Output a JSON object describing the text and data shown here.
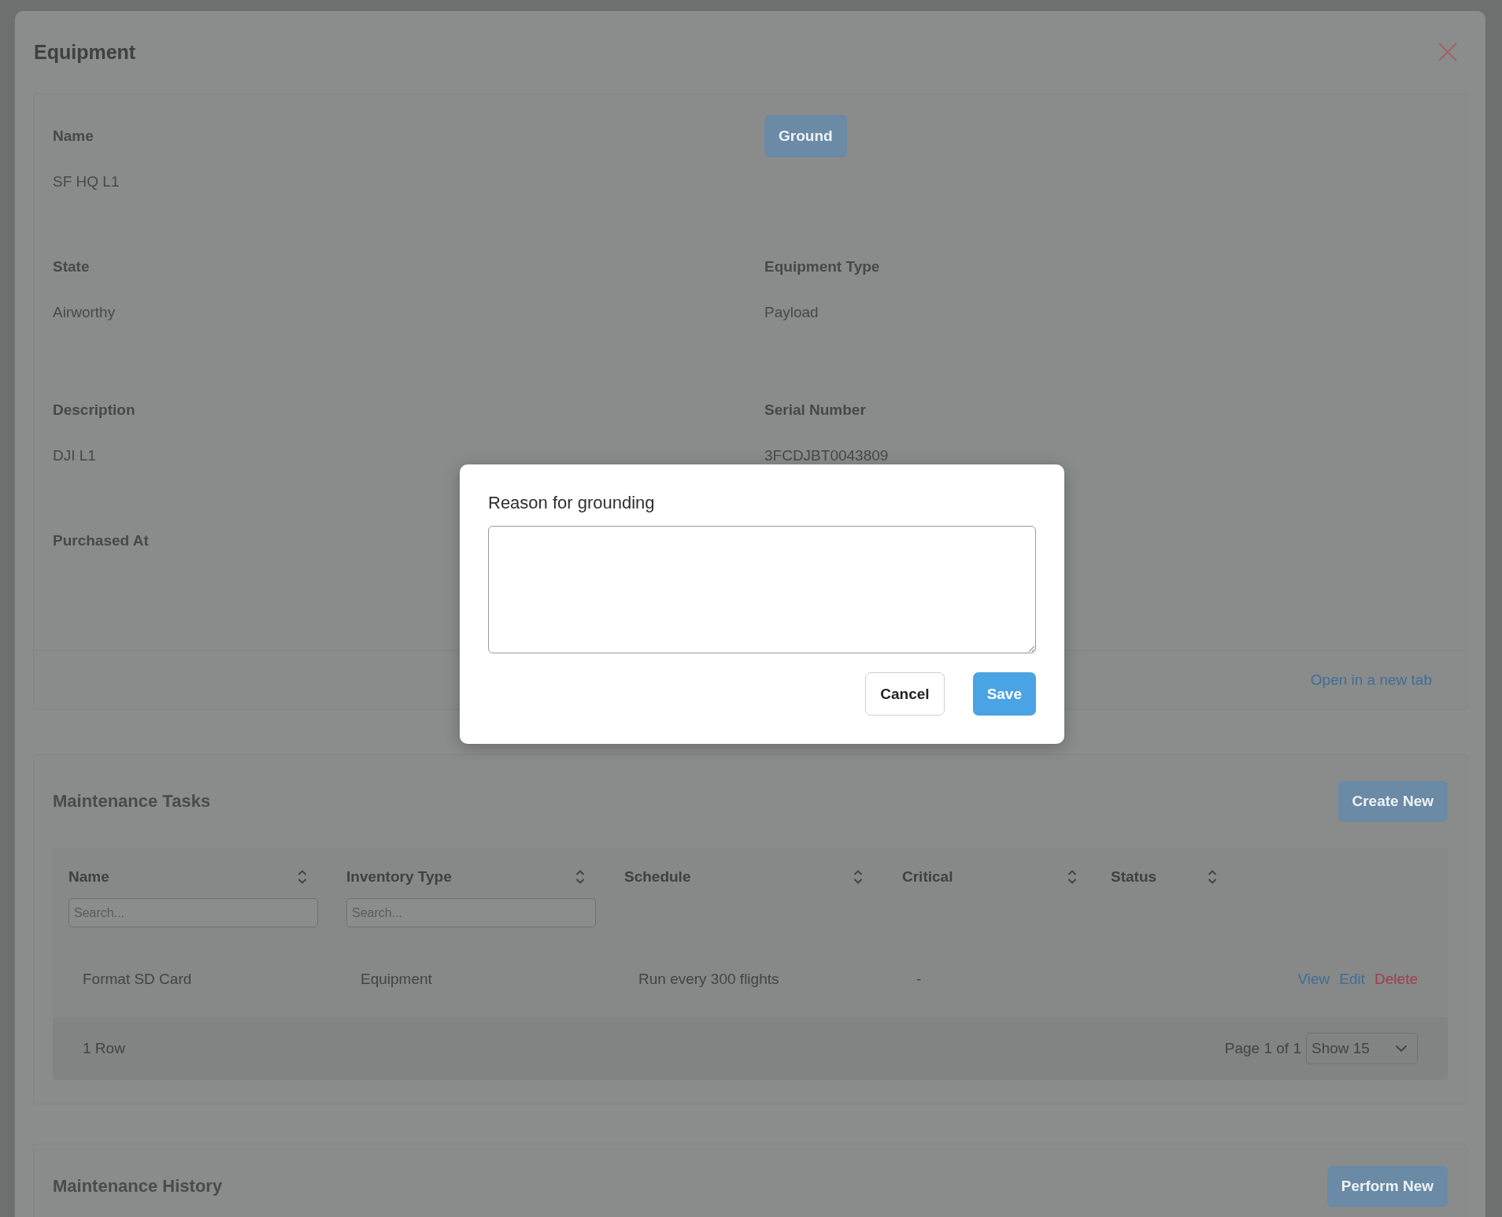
{
  "drawer": {
    "title": "Equipment",
    "details": {
      "items": [
        {
          "kind": "field",
          "label": "Name",
          "value": "SF HQ L1"
        },
        {
          "kind": "button",
          "label": "Ground"
        },
        {
          "kind": "field",
          "label": "State",
          "value": "Airworthy"
        },
        {
          "kind": "field",
          "label": "Equipment Type",
          "value": "Payload"
        },
        {
          "kind": "field",
          "label": "Description",
          "value": "DJI L1"
        },
        {
          "kind": "field",
          "label": "Serial Number",
          "value": "3FCDJBT0043809"
        },
        {
          "kind": "field",
          "label": "Purchased At"
        }
      ],
      "link": "Open in a new tab"
    },
    "maintenance_tasks": {
      "title": "Maintenance Tasks",
      "button": "Create New",
      "columns": [
        {
          "label": "Name",
          "placeholder": "Search..."
        },
        {
          "label": "Inventory Type",
          "placeholder": "Search..."
        },
        {
          "label": "Schedule"
        },
        {
          "label": "Critical"
        },
        {
          "label": "Status"
        }
      ],
      "rows": [
        {
          "cells": [
            "Format SD Card",
            "Equipment",
            "Run every 300 flights",
            "-"
          ],
          "actions": [
            {
              "label": "View",
              "kind": "link"
            },
            {
              "label": "Edit",
              "kind": "link"
            },
            {
              "label": "Delete",
              "kind": "danger"
            }
          ]
        }
      ],
      "row_count": "1 Row",
      "page": "Page 1 of 1",
      "page_size": "Show 15"
    },
    "maintenance_history": {
      "title": "Maintenance History",
      "button": "Perform New"
    }
  },
  "dialog": {
    "label": "Reason for grounding",
    "buttons": [
      {
        "label": "Cancel",
        "kind": "secondary"
      },
      {
        "label": "Save",
        "kind": "primary"
      }
    ]
  }
}
